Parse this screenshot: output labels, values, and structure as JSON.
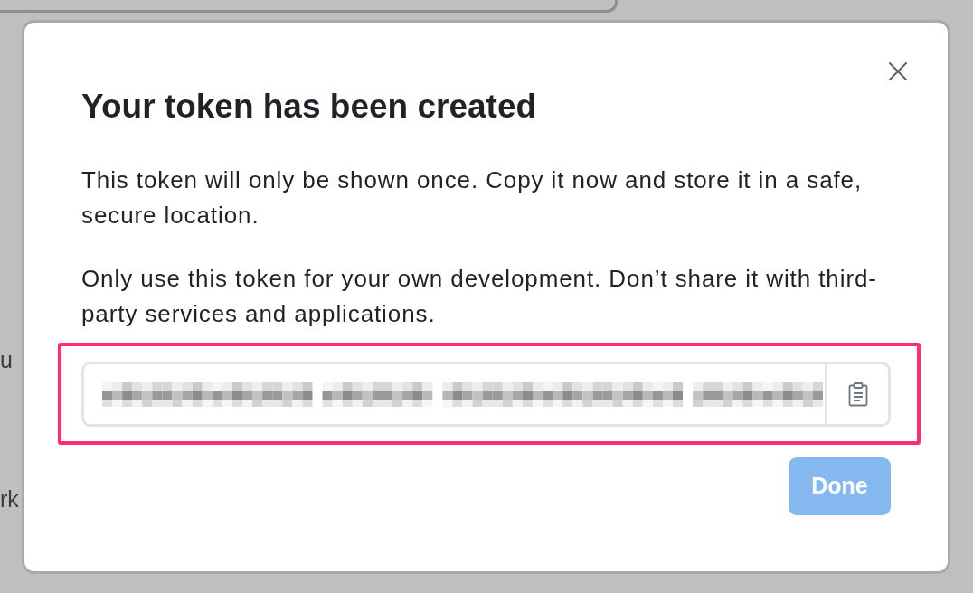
{
  "background_page": {
    "text_fragments": [
      "u",
      "rk"
    ]
  },
  "dialog": {
    "title": "Your token has been created",
    "paragraphs": [
      "This token will only be shown once. Copy it now and store it in a safe, secure location.",
      "Only use this token for your own development. Don’t share it with third-party services and applications."
    ],
    "token_field": {
      "highlighted": true
    },
    "done_button": {
      "label": "Done",
      "disabled": true
    }
  }
}
